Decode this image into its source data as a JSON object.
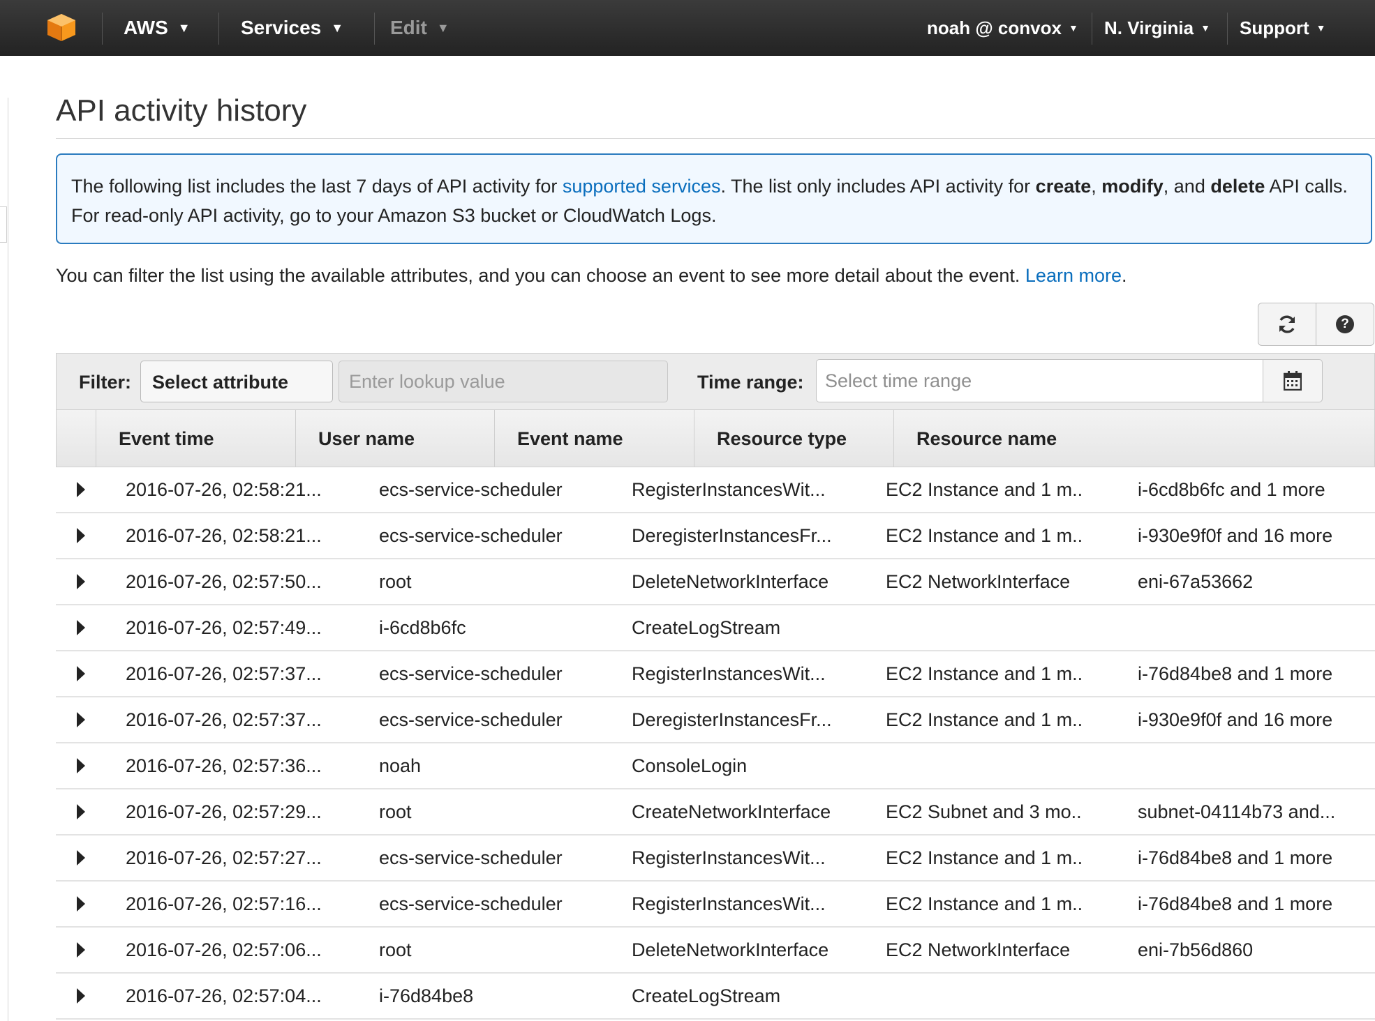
{
  "nav": {
    "aws_label": "AWS",
    "services_label": "Services",
    "edit_label": "Edit",
    "account_label": "noah @ convox",
    "region_label": "N. Virginia",
    "support_label": "Support",
    "logo_icon": "aws-cube-icon",
    "accent_color": "#f7981d"
  },
  "page": {
    "title": "API activity history",
    "info": {
      "text_1": "The following list includes the last 7 days of API activity for ",
      "link": "supported services",
      "text_2": ". The list only includes API activity for ",
      "bold_create": "create",
      "sep_1": ", ",
      "bold_modify": "modify",
      "text_3": ", and ",
      "bold_delete": "delete",
      "text_4": " API calls. For read-only API activity, go to your Amazon S3 bucket or CloudWatch Logs."
    },
    "filter_note": {
      "text": "You can filter the list using the available attributes, and you can choose an event to see more detail about the event. ",
      "link": "Learn more",
      "end": "."
    }
  },
  "toolbar": {
    "refresh_icon": "refresh-icon",
    "help_icon": "help-icon",
    "help_glyph": "?"
  },
  "filter": {
    "label": "Filter:",
    "attribute_selected": "Select attribute",
    "lookup_placeholder": "Enter lookup value",
    "time_label": "Time range:",
    "time_placeholder": "Select time range",
    "calendar_icon": "calendar-icon"
  },
  "table": {
    "columns": [
      "Event time",
      "User name",
      "Event name",
      "Resource type",
      "Resource name"
    ],
    "rows": [
      [
        "2016-07-26, 02:58:21...",
        "ecs-service-scheduler",
        "RegisterInstancesWit...",
        "EC2 Instance and 1 m..",
        "i-6cd8b6fc and 1 more"
      ],
      [
        "2016-07-26, 02:58:21...",
        "ecs-service-scheduler",
        "DeregisterInstancesFr...",
        "EC2 Instance and 1 m..",
        "i-930e9f0f and 16 more"
      ],
      [
        "2016-07-26, 02:57:50...",
        "root",
        "DeleteNetworkInterface",
        "EC2 NetworkInterface",
        "eni-67a53662"
      ],
      [
        "2016-07-26, 02:57:49...",
        "i-6cd8b6fc",
        "CreateLogStream",
        "",
        ""
      ],
      [
        "2016-07-26, 02:57:37...",
        "ecs-service-scheduler",
        "RegisterInstancesWit...",
        "EC2 Instance and 1 m..",
        "i-76d84be8 and 1 more"
      ],
      [
        "2016-07-26, 02:57:37...",
        "ecs-service-scheduler",
        "DeregisterInstancesFr...",
        "EC2 Instance and 1 m..",
        "i-930e9f0f and 16 more"
      ],
      [
        "2016-07-26, 02:57:36...",
        "noah",
        "ConsoleLogin",
        "",
        ""
      ],
      [
        "2016-07-26, 02:57:29...",
        "root",
        "CreateNetworkInterface",
        "EC2 Subnet and 3 mo..",
        "subnet-04114b73 and..."
      ],
      [
        "2016-07-26, 02:57:27...",
        "ecs-service-scheduler",
        "RegisterInstancesWit...",
        "EC2 Instance and 1 m..",
        "i-76d84be8 and 1 more"
      ],
      [
        "2016-07-26, 02:57:16...",
        "ecs-service-scheduler",
        "RegisterInstancesWit...",
        "EC2 Instance and 1 m..",
        "i-76d84be8 and 1 more"
      ],
      [
        "2016-07-26, 02:57:06...",
        "root",
        "DeleteNetworkInterface",
        "EC2 NetworkInterface",
        "eni-7b56d860"
      ],
      [
        "2016-07-26, 02:57:04...",
        "i-76d84be8",
        "CreateLogStream",
        "",
        ""
      ]
    ]
  }
}
